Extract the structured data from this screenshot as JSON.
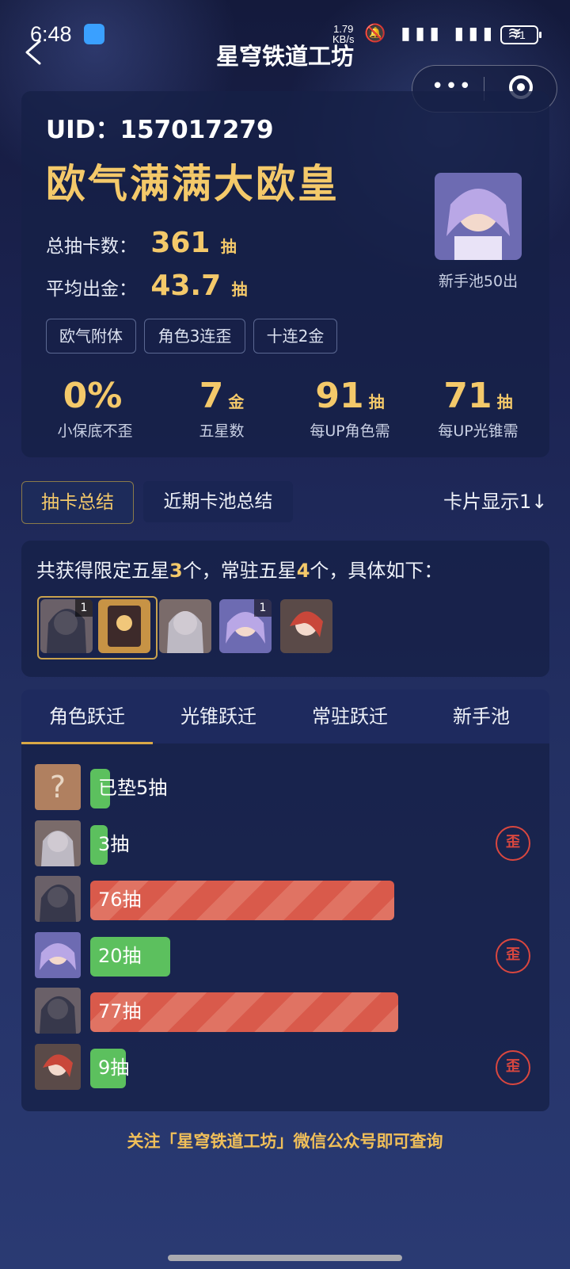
{
  "status_bar": {
    "time": "6:48",
    "net_speed": "1.79",
    "net_unit": "KB/s",
    "icons": "🔕 ▮▮▮ ▮▮▮ ≋",
    "battery": "71"
  },
  "page": {
    "title": "星穹铁道工坊",
    "more": "•••"
  },
  "profile": {
    "uid": "UID：157017279",
    "title": "欧气满满大欧皇",
    "total_label": "总抽卡数：",
    "total_value": "361",
    "total_unit": "抽",
    "avg_label": "平均出金：",
    "avg_value": "43.7",
    "avg_unit": "抽",
    "avatar_caption": "新手池50出",
    "tags": [
      "欧气附体",
      "角色3连歪",
      "十连2金"
    ]
  },
  "stats": [
    {
      "value": "0%",
      "unit": "",
      "label": "小保底不歪"
    },
    {
      "value": "7",
      "unit": "金",
      "label": "五星数"
    },
    {
      "value": "91",
      "unit": "抽",
      "label": "每UP角色需"
    },
    {
      "value": "71",
      "unit": "抽",
      "label": "每UP光锥需"
    }
  ],
  "mode_tabs": {
    "tab1": "抽卡总结",
    "tab2": "近期卡池总结",
    "display": "卡片显示1↓"
  },
  "summary": {
    "pre": "共获得限定五星",
    "limited": "3",
    "mid": "个，常驻五星",
    "standard": "4",
    "post": "个，具体如下："
  },
  "thumbs": [
    {
      "count": "1"
    },
    {
      "count": ""
    },
    {
      "count": ""
    },
    {
      "count": "1"
    },
    {
      "count": ""
    }
  ],
  "pool_tabs": [
    "角色跃迁",
    "光锥跃迁",
    "常驻跃迁",
    "新手池"
  ],
  "pulls": [
    {
      "label": "已垫5抽",
      "value": 5,
      "type": "green",
      "wai": ""
    },
    {
      "label": "3抽",
      "value": 3,
      "type": "green",
      "wai": "歪"
    },
    {
      "label": "76抽",
      "value": 76,
      "type": "red",
      "wai": ""
    },
    {
      "label": "20抽",
      "value": 20,
      "type": "green",
      "wai": "歪"
    },
    {
      "label": "77抽",
      "value": 77,
      "type": "red",
      "wai": ""
    },
    {
      "label": "9抽",
      "value": 9,
      "type": "green",
      "wai": "歪"
    }
  ],
  "unknown_mark": "?",
  "footer": "关注「星穹铁道工坊」微信公众号即可查询"
}
